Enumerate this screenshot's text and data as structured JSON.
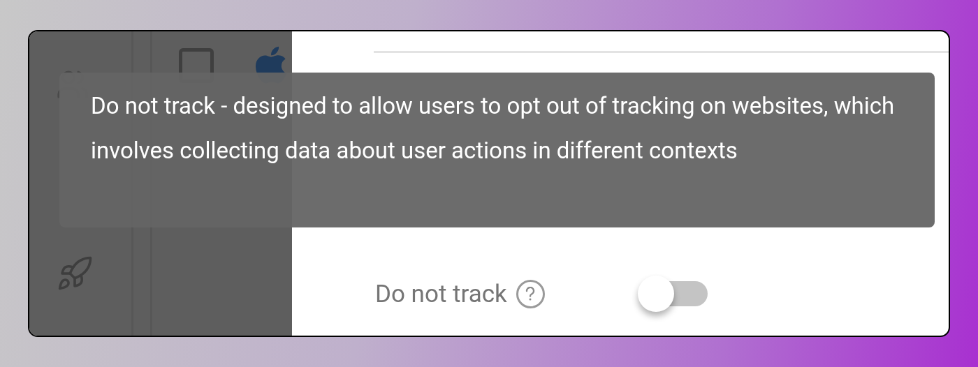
{
  "settings": {
    "do_not_track": {
      "label": "Do not track",
      "on": false
    }
  },
  "tooltip": {
    "text": "Do not track - designed to allow users to opt out of tracking on websites, which involves collecting data about user actions in different contexts"
  }
}
